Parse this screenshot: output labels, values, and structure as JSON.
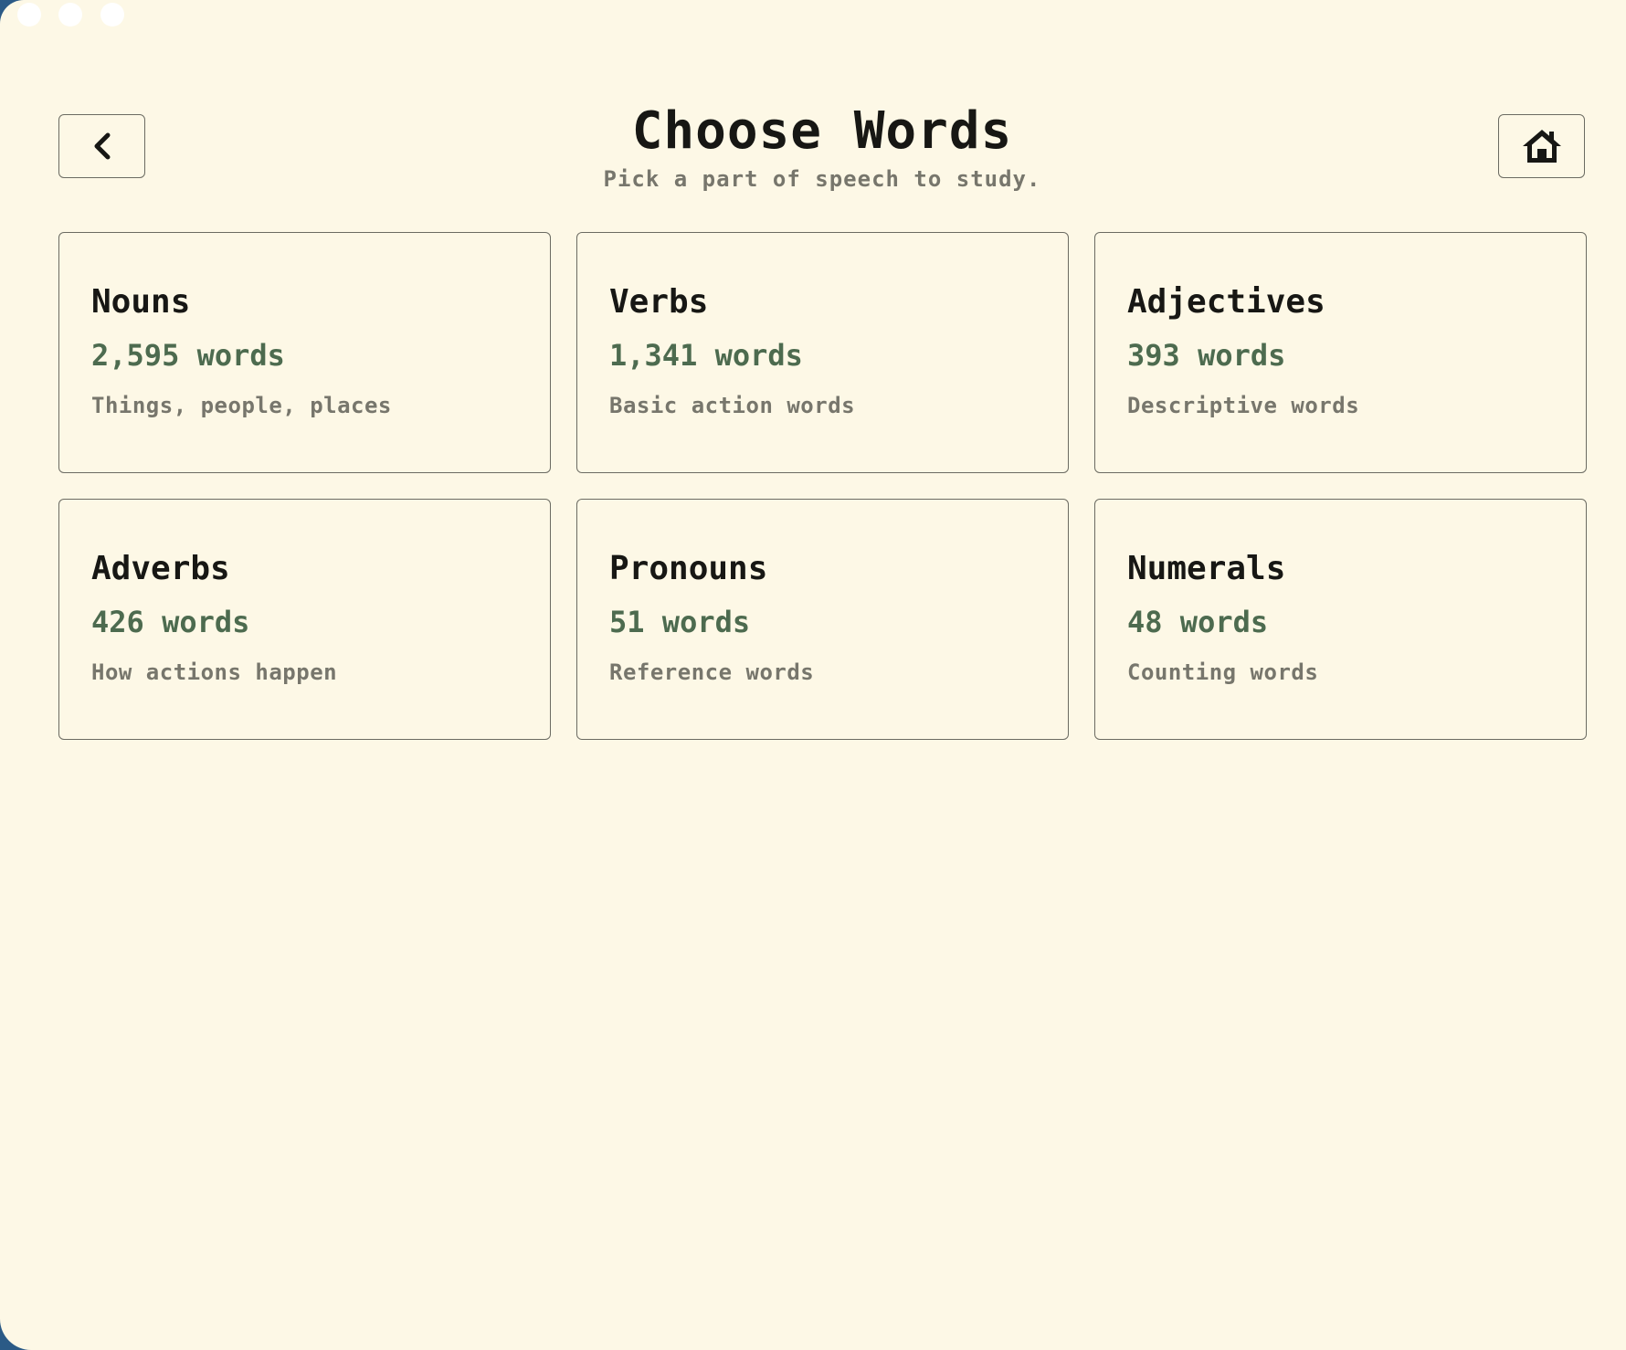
{
  "header": {
    "title": "Choose Words",
    "subtitle": "Pick a part of speech to study."
  },
  "toolbar": {
    "back_icon": "chevron-left-icon",
    "home_icon": "home-icon"
  },
  "categories": [
    {
      "name": "Nouns",
      "count": "2,595 words",
      "description": "Things, people, places"
    },
    {
      "name": "Verbs",
      "count": "1,341 words",
      "description": "Basic action words"
    },
    {
      "name": "Adjectives",
      "count": "393 words",
      "description": "Descriptive words"
    },
    {
      "name": "Adverbs",
      "count": "426 words",
      "description": "How actions happen"
    },
    {
      "name": "Pronouns",
      "count": "51 words",
      "description": "Reference words"
    },
    {
      "name": "Numerals",
      "count": "48 words",
      "description": "Counting words"
    }
  ],
  "colors": {
    "background": "#fdf8e6",
    "text": "#171714",
    "count": "#4d6b4f",
    "muted": "#77766c",
    "border": "#6b6b62"
  }
}
